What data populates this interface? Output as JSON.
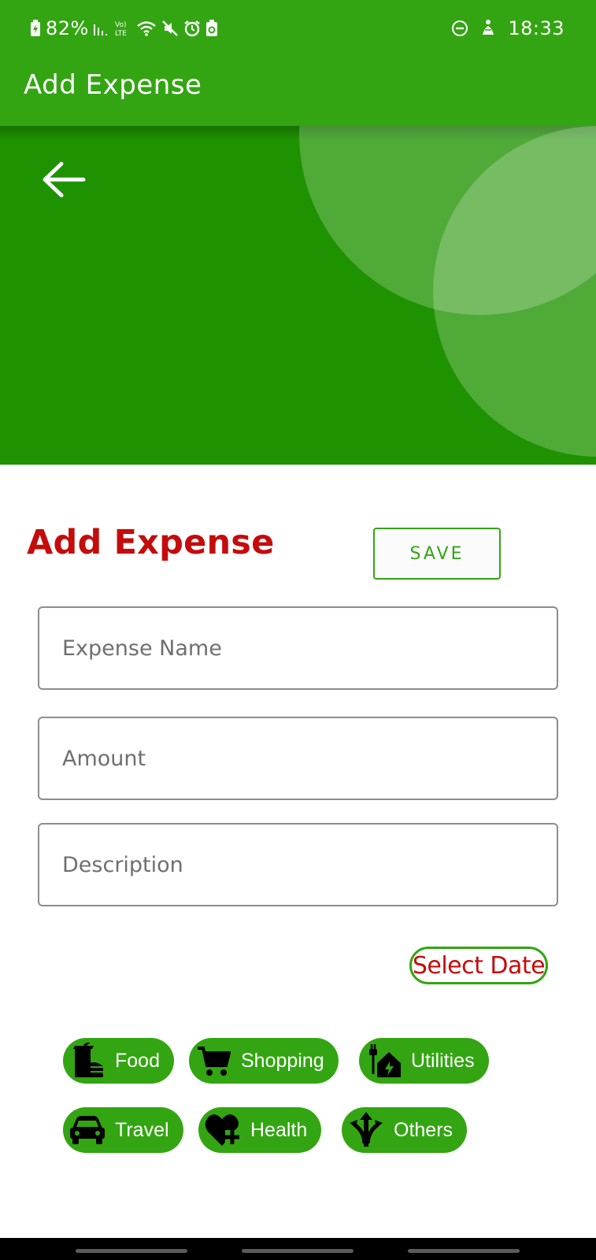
{
  "status_bar": {
    "battery_percent": "82%",
    "signal_label": "Vo) LTE",
    "time": "18:33",
    "icons": [
      "battery-charging-icon",
      "signal-icon",
      "volte-icon",
      "wifi-icon",
      "mute-icon",
      "alarm-icon",
      "battery-saver-icon",
      "dnd-icon",
      "accessibility-icon"
    ]
  },
  "app_bar": {
    "title": "Add Expense"
  },
  "hero": {
    "back_icon": "arrow-left-icon",
    "colors": {
      "bar": "#33a512",
      "hero": "#1e9200"
    }
  },
  "form": {
    "title": "Add Expense",
    "save_label": "SAVE",
    "fields": {
      "name_placeholder": "Expense Name",
      "amount_placeholder": "Amount",
      "description_placeholder": "Description"
    },
    "select_date_label": "Select Date"
  },
  "categories": [
    {
      "label": "Food",
      "icon": "food-icon"
    },
    {
      "label": "Shopping",
      "icon": "shopping-cart-icon"
    },
    {
      "label": "Utilities",
      "icon": "utilities-house-icon"
    },
    {
      "label": "Travel",
      "icon": "car-icon"
    },
    {
      "label": "Health",
      "icon": "heart-plus-icon"
    },
    {
      "label": "Others",
      "icon": "split-arrows-icon"
    }
  ],
  "colors": {
    "accent": "#33a512",
    "title_red": "#c40c0c"
  }
}
